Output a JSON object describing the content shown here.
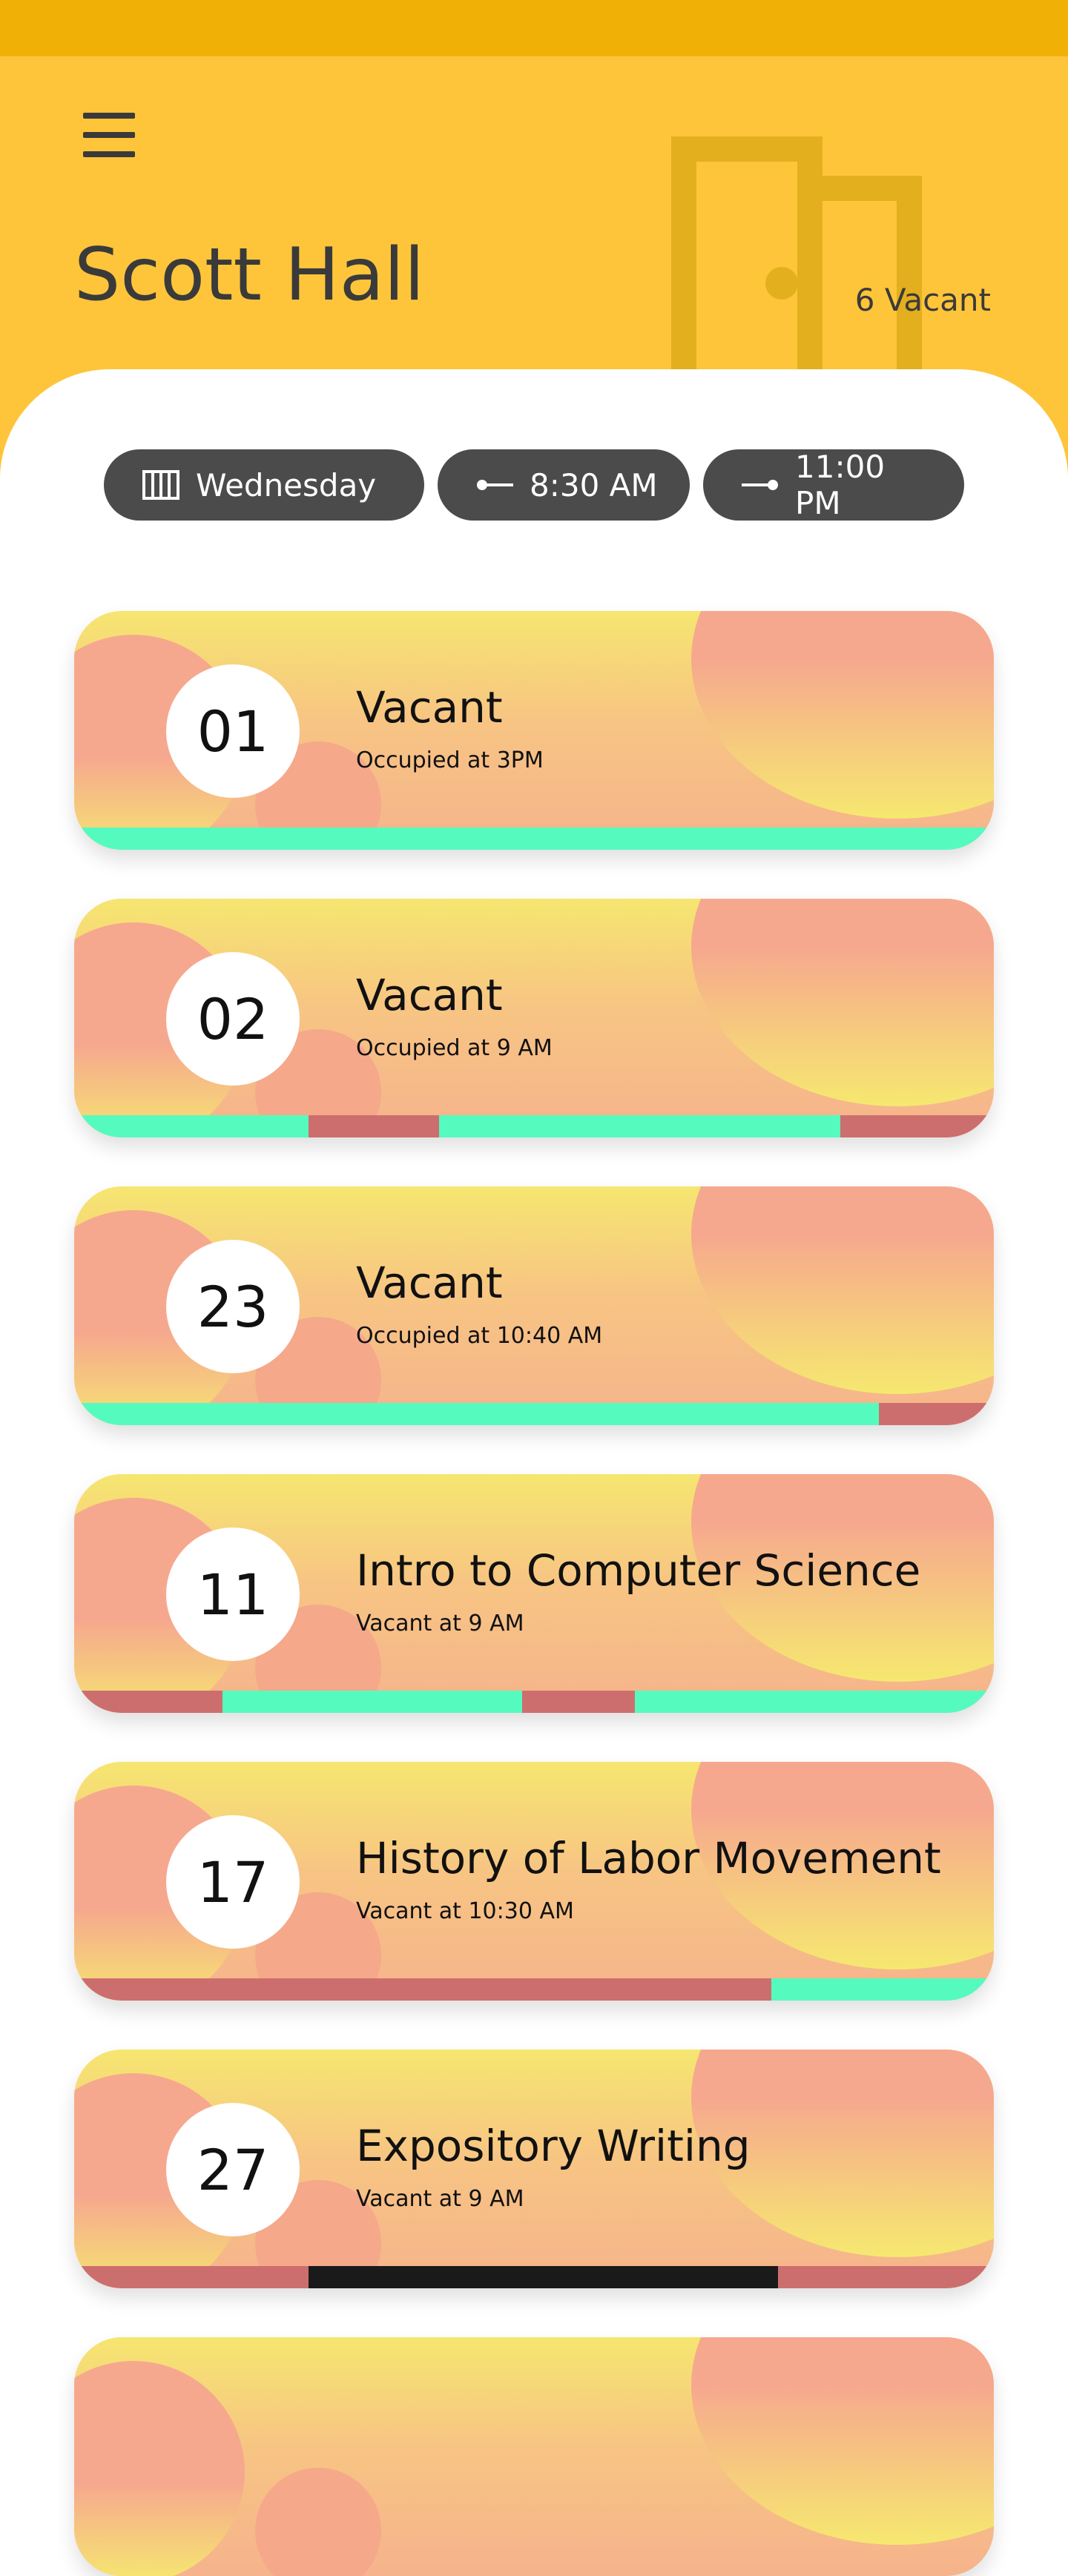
{
  "app": {
    "building_name": "Scott Hall",
    "vacant_count_label": "6 Vacant"
  },
  "filters": {
    "day": {
      "label": "Wednesday",
      "icon": "calendar-icon"
    },
    "start": {
      "label": "8:30 AM",
      "icon": "start-time-icon"
    },
    "end": {
      "label": "11:00 PM",
      "icon": "end-time-icon"
    }
  },
  "colors": {
    "status_bar": "#f1b005",
    "header": "#fec53a",
    "chip": "#4b4b4b",
    "vacant_segment": "#55fbbe",
    "occupied_segment": "#cd6e6e",
    "current_segment": "#1a1a1a"
  },
  "rooms": [
    {
      "number": "01",
      "status": "Vacant",
      "subtitle": "Occupied at 3PM",
      "timeline": [
        {
          "state": "vacant",
          "fraction": 1.0
        }
      ]
    },
    {
      "number": "02",
      "status": "Vacant",
      "subtitle": "Occupied at 9 AM",
      "timeline": [
        {
          "state": "vacant",
          "fraction": 0.255
        },
        {
          "state": "occupied",
          "fraction": 0.142
        },
        {
          "state": "vacant",
          "fraction": 0.436
        },
        {
          "state": "occupied",
          "fraction": 0.167
        }
      ]
    },
    {
      "number": "23",
      "status": "Vacant",
      "subtitle": "Occupied at 10:40 AM",
      "timeline": [
        {
          "state": "vacant",
          "fraction": 0.875
        },
        {
          "state": "occupied",
          "fraction": 0.125
        }
      ]
    },
    {
      "number": "11",
      "status": "Intro to Computer Science",
      "subtitle": "Vacant at 9 AM",
      "timeline": [
        {
          "state": "occupied",
          "fraction": 0.161
        },
        {
          "state": "vacant",
          "fraction": 0.326
        },
        {
          "state": "occupied",
          "fraction": 0.123
        },
        {
          "state": "vacant",
          "fraction": 0.39
        }
      ]
    },
    {
      "number": "17",
      "status": "History of Labor Movement",
      "subtitle": "Vacant at 10:30 AM",
      "timeline": [
        {
          "state": "occupied",
          "fraction": 0.758
        },
        {
          "state": "vacant",
          "fraction": 0.242
        }
      ]
    },
    {
      "number": "27",
      "status": "Expository Writing",
      "subtitle": "Vacant at 9 AM",
      "timeline": [
        {
          "state": "occupied",
          "fraction": 0.255
        },
        {
          "state": "current",
          "fraction": 0.51
        },
        {
          "state": "occupied",
          "fraction": 0.235
        }
      ]
    },
    {
      "number": "",
      "status": "",
      "subtitle": "",
      "timeline": []
    }
  ]
}
